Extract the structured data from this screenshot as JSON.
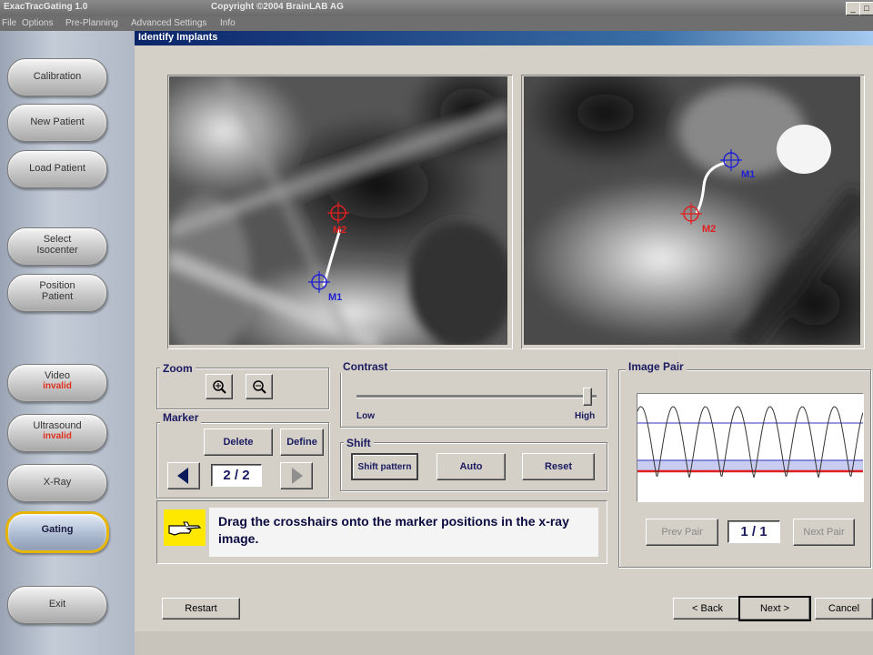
{
  "app": {
    "title": "ExacTracGating 1.0",
    "copyright": "Copyright ©2004 BrainLAB AG",
    "menu": [
      "File",
      "Options",
      "Pre-Planning",
      "Advanced Settings",
      "Info"
    ],
    "window_controls": [
      "_",
      "□"
    ]
  },
  "sidebar": {
    "items": [
      {
        "label": "Calibration",
        "sub": ""
      },
      {
        "label": "New Patient",
        "sub": ""
      },
      {
        "label": "Load Patient",
        "sub": ""
      },
      {
        "label": "Select\nIsocenter",
        "sub": ""
      },
      {
        "label": "Position\nPatient",
        "sub": ""
      },
      {
        "label": "Video",
        "sub": "invalid"
      },
      {
        "label": "Ultrasound",
        "sub": "invalid"
      },
      {
        "label": "X-Ray",
        "sub": ""
      },
      {
        "label": "Gating",
        "sub": "",
        "active": true
      },
      {
        "label": "Exit",
        "sub": ""
      }
    ]
  },
  "dialog": {
    "title": "Identify Implants",
    "xray_left": {
      "markers": [
        {
          "label": "M2",
          "color": "#e02020"
        },
        {
          "label": "M1",
          "color": "#2020d0"
        }
      ]
    },
    "xray_right": {
      "markers": [
        {
          "label": "M1",
          "color": "#2020d0"
        },
        {
          "label": "M2",
          "color": "#e02020"
        }
      ]
    },
    "zoom": {
      "label": "Zoom",
      "zoom_in_icon": "zoom-in-icon",
      "zoom_out_icon": "zoom-out-icon"
    },
    "marker": {
      "label": "Marker",
      "delete": "Delete",
      "define": "Define",
      "counter": "2 / 2",
      "current": 2,
      "total": 2
    },
    "contrast": {
      "label": "Contrast",
      "low": "Low",
      "high": "High",
      "value": 0.98
    },
    "shift": {
      "label": "Shift",
      "shift_pattern": "Shift pattern",
      "auto": "Auto",
      "reset": "Reset"
    },
    "instruction": {
      "text": "Drag the crosshairs onto the marker positions in the x-ray image.",
      "icon": "pointing-hand-icon"
    },
    "image_pair": {
      "label": "Image Pair",
      "prev": "Prev Pair",
      "next": "Next Pair",
      "counter": "1 / 1"
    },
    "footer": {
      "restart": "Restart",
      "back": "< Back",
      "next": "Next >",
      "cancel": "Cancel"
    },
    "colors": {
      "title_bar": "#0a246a",
      "accent_text": "#1a1a60",
      "threshold_red": "#e02020",
      "threshold_blue": "#3030c0",
      "gating_border": "#e7b400"
    }
  }
}
